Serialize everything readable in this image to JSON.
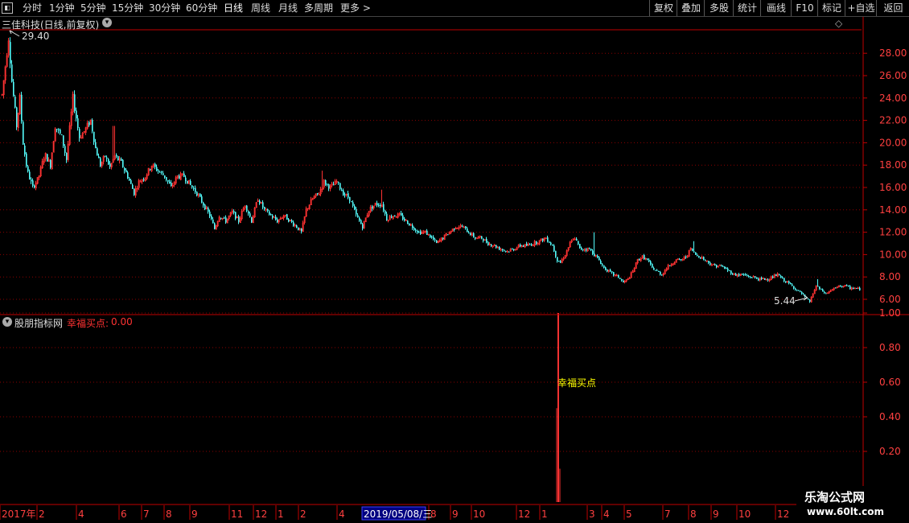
{
  "toolbar": {
    "left_items": [
      {
        "label": "分时"
      },
      {
        "label": "1分钟"
      },
      {
        "label": "5分钟"
      },
      {
        "label": "15分钟"
      },
      {
        "label": "30分钟"
      },
      {
        "label": "60分钟"
      },
      {
        "label": "日线",
        "active": true
      },
      {
        "label": "周线"
      },
      {
        "label": "月线"
      },
      {
        "label": "多周期"
      },
      {
        "label": "更多 >"
      }
    ],
    "right_items": [
      {
        "label": "复权"
      },
      {
        "label": "叠加"
      },
      {
        "label": "多股"
      },
      {
        "label": "统计"
      },
      {
        "label": "画线"
      },
      {
        "label": "F10"
      },
      {
        "label": "标记"
      },
      {
        "label": "+自选"
      },
      {
        "label": "返回"
      }
    ]
  },
  "price_panel": {
    "title": "三佳科技(日线,前复权)",
    "high_label": "29.40",
    "low_label": "5.44",
    "diamond_icon": "◇",
    "y_ticks": [
      "28.00",
      "26.00",
      "24.00",
      "22.00",
      "20.00",
      "18.00",
      "16.00",
      "14.00",
      "12.00",
      "10.00",
      "8.00",
      "6.00"
    ]
  },
  "indicator_panel": {
    "name": "股朋指标网",
    "series_label": "幸福买点:",
    "series_value": "0.00",
    "signal_label": "幸福买点",
    "y_ticks": [
      "1.00",
      "0.80",
      "0.60",
      "0.40",
      "0.20"
    ]
  },
  "x_axis": {
    "labels": [
      "2017年",
      "2",
      "4",
      "6",
      "7",
      "8",
      "9",
      "11",
      "12",
      "1",
      "2",
      "4",
      "8",
      "9",
      "10",
      "12",
      "1",
      "3",
      "4",
      "5",
      "7",
      "8",
      "9",
      "10",
      "12"
    ],
    "cursor_date": "2019/05/08/三"
  },
  "colors": {
    "up": "#ff3232",
    "down": "#54fcfc",
    "grid": "#8b0000",
    "axis": "#c00000",
    "cursor_bg": "#000080",
    "signal_text": "#ffff00"
  },
  "watermark": {
    "line1": "乐淘公式网",
    "line2": "www.60lt.com"
  },
  "chart_data": {
    "type": "candlestick",
    "price_range": [
      4.9,
      30.2
    ],
    "indicator_range": [
      0,
      1.1
    ],
    "anchors": [
      [
        0,
        23.0
      ],
      [
        7,
        27.5
      ],
      [
        10,
        29.4
      ],
      [
        14,
        25.5
      ],
      [
        20,
        21.5
      ],
      [
        24,
        24.0
      ],
      [
        28,
        20.0
      ],
      [
        33,
        17.5
      ],
      [
        40,
        16.0
      ],
      [
        47,
        16.8
      ],
      [
        55,
        19.0
      ],
      [
        62,
        18.0
      ],
      [
        68,
        21.5
      ],
      [
        76,
        20.5
      ],
      [
        82,
        18.5
      ],
      [
        90,
        24.0
      ],
      [
        98,
        20.5
      ],
      [
        104,
        21.0
      ],
      [
        112,
        22.0
      ],
      [
        118,
        19.5
      ],
      [
        124,
        18.0
      ],
      [
        130,
        18.8
      ],
      [
        136,
        17.8
      ],
      [
        142,
        18.8
      ],
      [
        150,
        18.2
      ],
      [
        158,
        17.0
      ],
      [
        166,
        15.5
      ],
      [
        172,
        16.5
      ],
      [
        180,
        17.0
      ],
      [
        188,
        18.0
      ],
      [
        196,
        17.5
      ],
      [
        204,
        17.0
      ],
      [
        212,
        16.0
      ],
      [
        220,
        17.0
      ],
      [
        228,
        17.0
      ],
      [
        236,
        16.2
      ],
      [
        244,
        15.5
      ],
      [
        252,
        14.5
      ],
      [
        260,
        13.5
      ],
      [
        266,
        12.3
      ],
      [
        272,
        13.5
      ],
      [
        280,
        13.0
      ],
      [
        288,
        13.8
      ],
      [
        296,
        13.0
      ],
      [
        304,
        14.5
      ],
      [
        312,
        13.0
      ],
      [
        320,
        15.0
      ],
      [
        328,
        14.0
      ],
      [
        336,
        13.5
      ],
      [
        344,
        13.0
      ],
      [
        352,
        13.5
      ],
      [
        360,
        13.0
      ],
      [
        368,
        12.5
      ],
      [
        374,
        12.0
      ],
      [
        380,
        14.0
      ],
      [
        388,
        15.0
      ],
      [
        396,
        15.5
      ],
      [
        402,
        16.5
      ],
      [
        410,
        16.0
      ],
      [
        418,
        16.5
      ],
      [
        426,
        15.5
      ],
      [
        434,
        15.0
      ],
      [
        442,
        13.5
      ],
      [
        450,
        12.5
      ],
      [
        458,
        14.0
      ],
      [
        466,
        14.5
      ],
      [
        474,
        14.5
      ],
      [
        480,
        13.2
      ],
      [
        488,
        13.5
      ],
      [
        496,
        13.5
      ],
      [
        504,
        13.0
      ],
      [
        512,
        12.5
      ],
      [
        520,
        12.0
      ],
      [
        528,
        12.0
      ],
      [
        536,
        11.5
      ],
      [
        542,
        11.0
      ],
      [
        550,
        11.5
      ],
      [
        558,
        12.0
      ],
      [
        566,
        12.5
      ],
      [
        574,
        12.5
      ],
      [
        582,
        12.0
      ],
      [
        590,
        11.5
      ],
      [
        598,
        11.5
      ],
      [
        606,
        11.0
      ],
      [
        614,
        10.8
      ],
      [
        622,
        10.5
      ],
      [
        630,
        10.3
      ],
      [
        638,
        10.5
      ],
      [
        646,
        10.8
      ],
      [
        654,
        10.8
      ],
      [
        662,
        11.0
      ],
      [
        670,
        11.2
      ],
      [
        678,
        11.5
      ],
      [
        686,
        10.8
      ],
      [
        692,
        9.5
      ],
      [
        696,
        9.3
      ],
      [
        702,
        10.0
      ],
      [
        708,
        11.0
      ],
      [
        714,
        11.5
      ],
      [
        720,
        10.5
      ],
      [
        726,
        10.5
      ],
      [
        732,
        10.5
      ],
      [
        738,
        10.0
      ],
      [
        744,
        9.5
      ],
      [
        750,
        8.8
      ],
      [
        756,
        8.5
      ],
      [
        762,
        8.2
      ],
      [
        768,
        8.0
      ],
      [
        774,
        7.5
      ],
      [
        780,
        7.8
      ],
      [
        786,
        8.5
      ],
      [
        792,
        9.5
      ],
      [
        798,
        9.8
      ],
      [
        804,
        9.5
      ],
      [
        810,
        8.8
      ],
      [
        816,
        8.5
      ],
      [
        822,
        8.2
      ],
      [
        828,
        8.8
      ],
      [
        834,
        9.2
      ],
      [
        840,
        9.5
      ],
      [
        846,
        9.5
      ],
      [
        852,
        9.8
      ],
      [
        858,
        10.5
      ],
      [
        864,
        10.0
      ],
      [
        870,
        9.8
      ],
      [
        876,
        9.5
      ],
      [
        882,
        9.2
      ],
      [
        888,
        9.0
      ],
      [
        894,
        9.0
      ],
      [
        900,
        8.8
      ],
      [
        906,
        8.5
      ],
      [
        912,
        8.2
      ],
      [
        918,
        8.2
      ],
      [
        924,
        8.2
      ],
      [
        930,
        8.0
      ],
      [
        936,
        8.0
      ],
      [
        942,
        7.8
      ],
      [
        948,
        7.8
      ],
      [
        954,
        7.8
      ],
      [
        960,
        8.0
      ],
      [
        966,
        8.2
      ],
      [
        972,
        7.8
      ],
      [
        978,
        7.5
      ],
      [
        984,
        7.2
      ],
      [
        990,
        6.8
      ],
      [
        996,
        6.5
      ],
      [
        1002,
        6.0
      ],
      [
        1006,
        5.8
      ],
      [
        1010,
        6.5
      ],
      [
        1014,
        7.2
      ],
      [
        1020,
        6.8
      ],
      [
        1026,
        6.5
      ],
      [
        1032,
        6.8
      ],
      [
        1038,
        7.0
      ],
      [
        1044,
        7.2
      ],
      [
        1050,
        7.2
      ],
      [
        1056,
        7.0
      ],
      [
        1062,
        7.0
      ],
      [
        1068,
        6.9
      ]
    ],
    "spikes": [
      [
        13,
        22.0
      ],
      [
        141,
        21.5
      ],
      [
        400,
        17.5
      ],
      [
        474,
        15.8
      ],
      [
        738,
        12.0
      ],
      [
        862,
        11.2
      ],
      [
        1016,
        7.8
      ]
    ],
    "indicator_spike": {
      "x": 694,
      "value": 1.0
    }
  }
}
